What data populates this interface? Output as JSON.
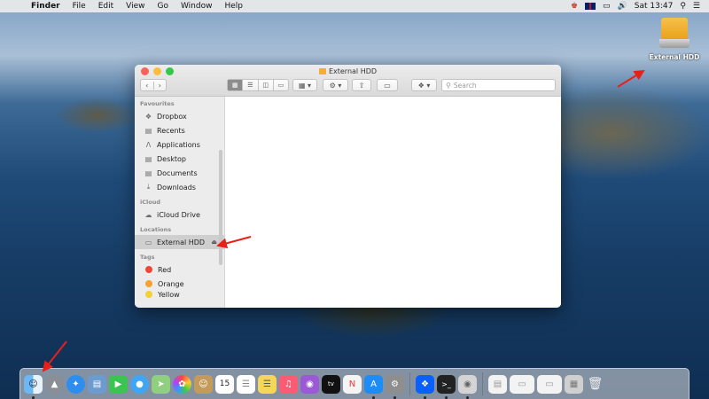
{
  "menubar": {
    "app_name": "Finder",
    "items": [
      "File",
      "Edit",
      "View",
      "Go",
      "Window",
      "Help"
    ],
    "clock": "Sat 13:47"
  },
  "desktop": {
    "drive_label": "External HDD"
  },
  "window": {
    "title": "External HDD",
    "search_placeholder": "Search",
    "sidebar": {
      "favourites_title": "Favourites",
      "favourites": [
        {
          "label": "Dropbox",
          "icon": "dropbox-icon"
        },
        {
          "label": "Recents",
          "icon": "recents-icon"
        },
        {
          "label": "Applications",
          "icon": "applications-icon"
        },
        {
          "label": "Desktop",
          "icon": "desktop-icon"
        },
        {
          "label": "Documents",
          "icon": "documents-icon"
        },
        {
          "label": "Downloads",
          "icon": "downloads-icon"
        }
      ],
      "icloud_title": "iCloud",
      "icloud": [
        {
          "label": "iCloud Drive",
          "icon": "cloud-icon"
        }
      ],
      "locations_title": "Locations",
      "locations": [
        {
          "label": "External HDD",
          "icon": "drive-icon"
        }
      ],
      "tags_title": "Tags",
      "tags": [
        {
          "label": "Red",
          "color": "#f0453a"
        },
        {
          "label": "Orange",
          "color": "#f7a032"
        },
        {
          "label": "Yellow",
          "color": "#f5d033"
        }
      ]
    }
  },
  "colors": {
    "annotation_arrow": "#e8201a",
    "selection": "#cfcfcf"
  }
}
